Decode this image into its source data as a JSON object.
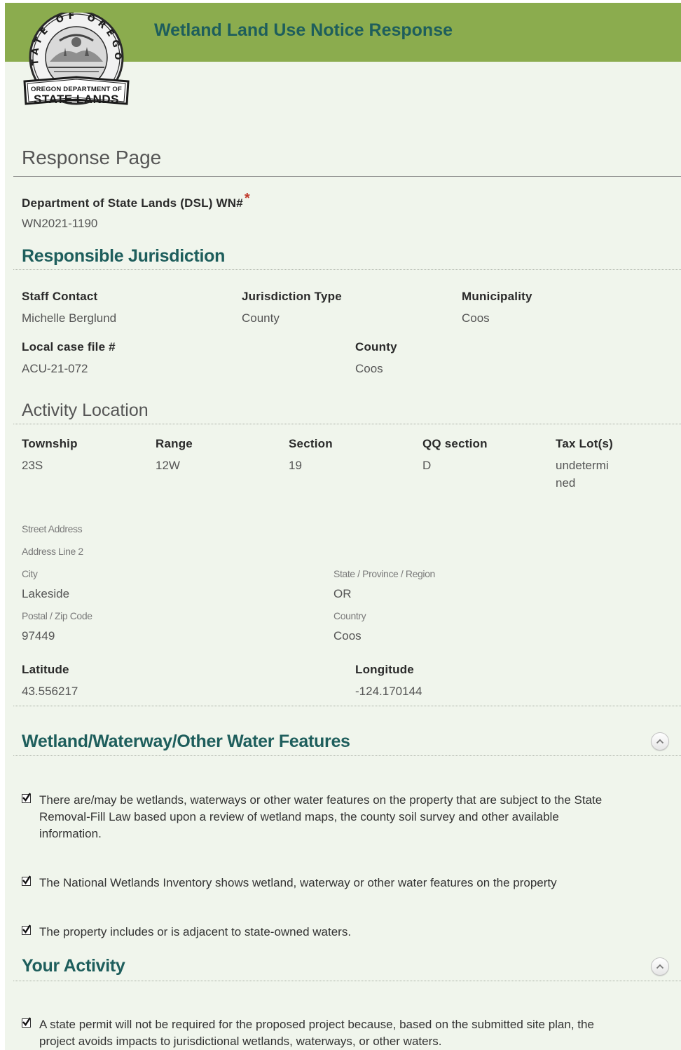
{
  "header": {
    "title": "Wetland Land Use Notice Response",
    "logo": {
      "ring_text": "STATE OF OREGON",
      "banner_line1": "OREGON DEPARTMENT OF",
      "banner_line2": "STATE LANDS"
    }
  },
  "page_title": "Response Page",
  "wn": {
    "label": "Department of State Lands (DSL) WN#",
    "required_mark": "*",
    "value": "WN2021-1190"
  },
  "jurisdiction": {
    "title": "Responsible Jurisdiction",
    "staff_contact": {
      "label": "Staff Contact",
      "value": "Michelle Berglund"
    },
    "jurisdiction_type": {
      "label": "Jurisdiction Type",
      "value": "County"
    },
    "municipality": {
      "label": "Municipality",
      "value": "Coos"
    },
    "local_case_file": {
      "label": "Local case file #",
      "value": "ACU-21-072"
    },
    "county": {
      "label": "County",
      "value": "Coos"
    }
  },
  "location": {
    "title": "Activity Location",
    "township": {
      "label": "Township",
      "value": "23S"
    },
    "range": {
      "label": "Range",
      "value": "12W"
    },
    "section": {
      "label": "Section",
      "value": "19"
    },
    "qq_section": {
      "label": "QQ section",
      "value": "D"
    },
    "tax_lots": {
      "label": "Tax Lot(s)",
      "value": "undetermined"
    },
    "street_address": {
      "label": "Street Address",
      "value": ""
    },
    "address_line2": {
      "label": "Address Line 2",
      "value": ""
    },
    "city": {
      "label": "City",
      "value": "Lakeside"
    },
    "state": {
      "label": "State / Province / Region",
      "value": "OR"
    },
    "postal": {
      "label": "Postal / Zip Code",
      "value": "97449"
    },
    "country": {
      "label": "Country",
      "value": "Coos"
    },
    "latitude": {
      "label": "Latitude",
      "value": "43.556217"
    },
    "longitude": {
      "label": "Longitude",
      "value": "-124.170144"
    }
  },
  "water_features": {
    "title": "Wetland/Waterway/Other Water Features",
    "items": [
      {
        "checked": true,
        "text": "There are/may be wetlands, waterways or other water features on the property that are subject to the State Removal-Fill Law based upon a review of wetland maps, the county soil survey and other available information."
      },
      {
        "checked": true,
        "text": "The National Wetlands Inventory shows wetland, waterway or other water features on the property"
      },
      {
        "checked": true,
        "text": "The property includes or is adjacent to state-owned waters."
      }
    ]
  },
  "activity": {
    "title": "Your Activity",
    "items": [
      {
        "checked": true,
        "text": "A state permit will not be required for the proposed project because, based on the submitted site plan, the project avoids impacts to jurisdictional wetlands, waterways, or other waters."
      }
    ]
  },
  "colors": {
    "banner": "#8bac4e",
    "heading": "#1e5e5c",
    "page_bg": "#f0f5ec",
    "required": "#c0392b"
  },
  "icons": {
    "logo": "oregon-state-seal",
    "collapse": "chevron-up-icon",
    "checkbox": "checkmark-icon"
  }
}
